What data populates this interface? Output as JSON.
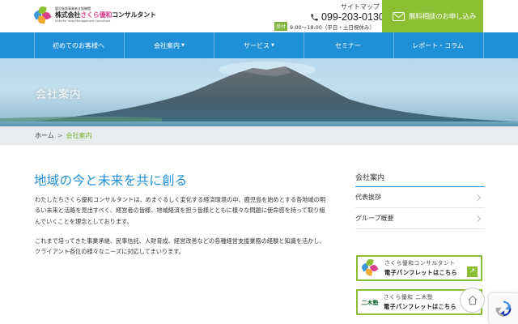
{
  "header": {
    "logo": {
      "small_text": "鹿児島県事業者支援機関",
      "name_prefix": "株式会社",
      "name_accent": "さくら優和",
      "name_suffix": "コンサルタント",
      "english": "SAKURA Yuwa Management Consultant"
    },
    "sitemap_label": "サイトマップ",
    "phone": "099-203-0130",
    "hours_badge": "受付",
    "hours": "9:00〜18:00（平日・土日祝休み）",
    "cta_label": "無料相談のお申し込み"
  },
  "nav": {
    "items": [
      {
        "label": "初めてのお客様へ",
        "caret": ""
      },
      {
        "label": "会社案内",
        "caret": "▼"
      },
      {
        "label": "サービス",
        "caret": "▼"
      },
      {
        "label": "セミナー",
        "caret": ""
      },
      {
        "label": "レポート・コラム",
        "caret": ""
      }
    ]
  },
  "hero": {
    "title": "会社案内"
  },
  "breadcrumb": {
    "home": "ホーム",
    "separator": ">",
    "current": "会社案内"
  },
  "main": {
    "heading": "地域の今と未来を共に創る",
    "paragraph1": "わたしたちさくら優和コンサルタントは、めまぐるしく変化する経済環境の中、鹿児島を始めとする各地域の明るい未来と活路を見出すべく、経営者の皆様、地域経済を担う皆様とともに様々な問題に使命感を持って取り組んでいくことを理念としております。",
    "paragraph2": "これまで培ってきた事業承継、民事信託、人財育成、経営改善などの各種経営支援業務の経験と知識を活かし、クライアント各位の様々なニーズに対応してまいります。"
  },
  "sidebar": {
    "title": "会社案内",
    "items": [
      {
        "label": "代表挨拶"
      },
      {
        "label": "グループ概要"
      }
    ],
    "banners": [
      {
        "line1": "さくら優和コンサルタント",
        "line2": "電子パンフレットはこちら"
      },
      {
        "line1": "さくら優和 二木塾",
        "line2": "電子パンフレットはこちら",
        "mark": "二木塾"
      }
    ]
  },
  "colors": {
    "brand_blue": "#1f8fd7",
    "brand_green": "#8cbe34",
    "brand_pink": "#d9408c"
  },
  "icons": [
    "phone-icon",
    "mail-icon",
    "chevron-right-icon",
    "arrow-up-right-icon",
    "home-icon",
    "recaptcha-icon"
  ]
}
